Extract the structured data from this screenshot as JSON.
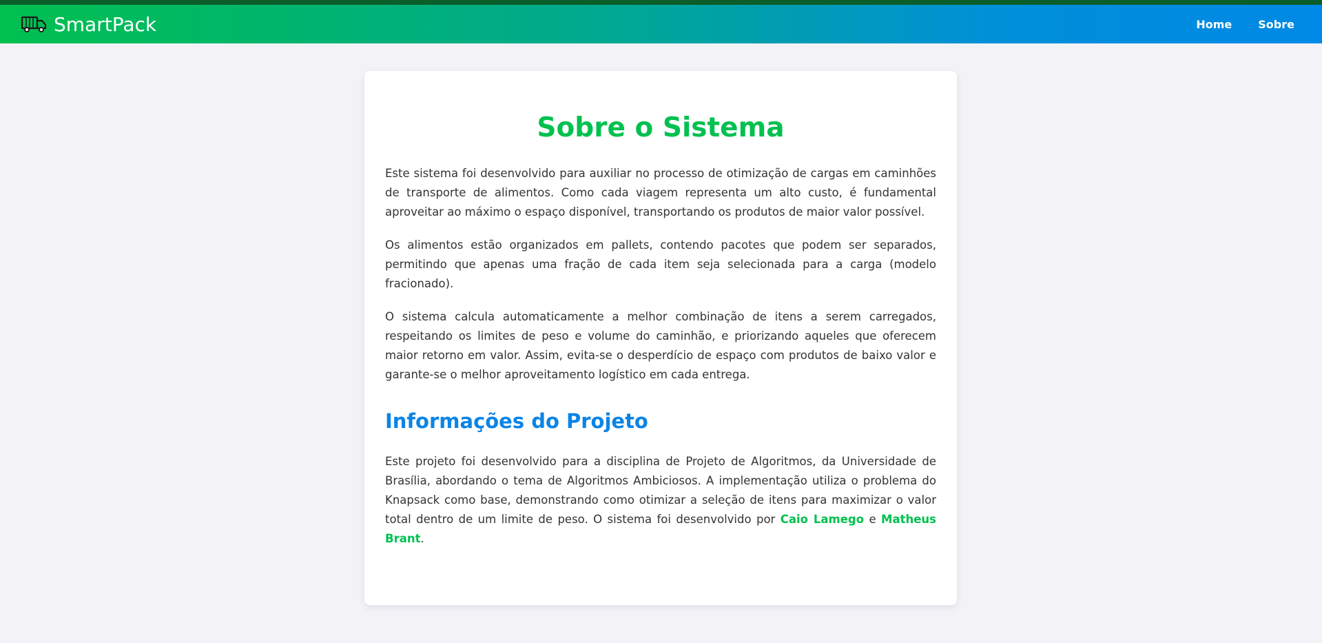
{
  "navbar": {
    "brand": "SmartPack",
    "brand_icon": "truck-icon",
    "links": [
      "Home",
      "Sobre"
    ]
  },
  "content": {
    "title": "Sobre o Sistema",
    "paragraphs": [
      "Este sistema foi desenvolvido para auxiliar no processo de otimização de cargas em caminhões de transporte de alimentos. Como cada viagem representa um alto custo, é fundamental aproveitar ao máximo o espaço disponível, transportando os produtos de maior valor possível.",
      "Os alimentos estão organizados em pallets, contendo pacotes que podem ser separados, permitindo que apenas uma fração de cada item seja selecionada para a carga (modelo fracionado).",
      "O sistema calcula automaticamente a melhor combinação de itens a serem carregados, respeitando os limites de peso e volume do caminhão, e priorizando aqueles que oferecem maior retorno em valor. Assim, evita-se o desperdício de espaço com produtos de baixo valor e garante-se o melhor aproveitamento logístico em cada entrega."
    ],
    "project_heading": "Informações do Projeto",
    "project_text": "Este projeto foi desenvolvido para a disciplina de Projeto de Algoritmos, da Universidade de Brasília, abordando o tema de Algoritmos Ambiciosos. A implementação utiliza o problema do Knapsack como base, demonstrando como otimizar a seleção de itens para maximizar o valor total dentro de um limite de peso. O sistema foi desenvolvido por ",
    "author1": "Caio Lamego",
    "conjunction": " e ",
    "author2": "Matheus Brant",
    "end_punct": "."
  },
  "colors": {
    "green": "#00c04f",
    "blue": "#0b84e6",
    "background": "#f2f2f7"
  }
}
